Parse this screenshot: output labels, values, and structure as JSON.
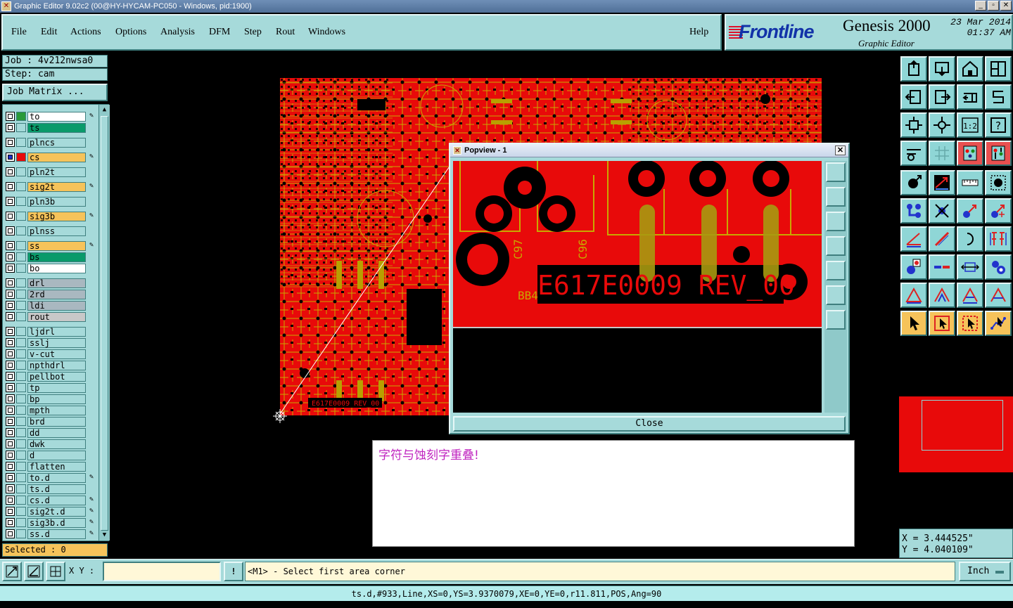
{
  "window": {
    "title": "Graphic Editor 9.02c2 (00@HY-HYCAM-PC050 - Windows, pid:1900)",
    "min": "_",
    "max": "▫",
    "close": "✕",
    "app_glyph": "✕"
  },
  "menu": {
    "file": "File",
    "edit": "Edit",
    "actions": "Actions",
    "options": "Options",
    "analysis": "Analysis",
    "dfm": "DFM",
    "step": "Step",
    "rout": "Rout",
    "windows": "Windows",
    "help": "Help"
  },
  "brand": {
    "logo": "Frontline",
    "product": "Genesis 2000",
    "subtitle": "Graphic Editor",
    "date": "23 Mar 2014",
    "time": "01:37 AM"
  },
  "job": {
    "job_label": "Job : 4v212nwsa0",
    "step_label": "Step: cam",
    "matrix_button": "Job Matrix ..."
  },
  "layers": [
    {
      "name": "to",
      "bg": "#ffffff",
      "swatch": "#2a9a3a",
      "pen": true
    },
    {
      "name": "ts",
      "bg": "#0a9a6a",
      "swatch": "",
      "pen": false
    },
    {
      "name": "plncs",
      "bg": "#a6dada",
      "swatch": "",
      "pen": false
    },
    {
      "name": "cs",
      "bg": "#f6c35a",
      "swatch": "#e80a0a",
      "pen": true,
      "active": true
    },
    {
      "name": "pln2t",
      "bg": "#a6dada",
      "swatch": "",
      "pen": false
    },
    {
      "name": "sig2t",
      "bg": "#f6c35a",
      "swatch": "",
      "pen": true
    },
    {
      "name": "pln3b",
      "bg": "#a6dada",
      "swatch": "",
      "pen": false
    },
    {
      "name": "sig3b",
      "bg": "#f6c35a",
      "swatch": "",
      "pen": true
    },
    {
      "name": "plnss",
      "bg": "#a6dada",
      "swatch": "",
      "pen": false
    },
    {
      "name": "ss",
      "bg": "#f6c35a",
      "swatch": "",
      "pen": true
    },
    {
      "name": "bs",
      "bg": "#0a9a6a",
      "swatch": "",
      "pen": false
    },
    {
      "name": "bo",
      "bg": "#ffffff",
      "swatch": "",
      "pen": false
    },
    {
      "name": "drl",
      "bg": "#a9b8c0",
      "swatch": "",
      "pen": false
    },
    {
      "name": "2rd",
      "bg": "#a9b8c0",
      "swatch": "",
      "pen": false
    },
    {
      "name": "ldi",
      "bg": "#a9b8c0",
      "swatch": "",
      "pen": false
    },
    {
      "name": "rout",
      "bg": "#c8c8c8",
      "swatch": "",
      "pen": false
    },
    {
      "name": "ljdrl",
      "bg": "#a6dada",
      "swatch": "",
      "pen": false
    },
    {
      "name": "sslj",
      "bg": "#a6dada",
      "swatch": "",
      "pen": false
    },
    {
      "name": "v-cut",
      "bg": "#a6dada",
      "swatch": "",
      "pen": false
    },
    {
      "name": "npthdrl",
      "bg": "#a6dada",
      "swatch": "",
      "pen": false
    },
    {
      "name": "pellbot",
      "bg": "#a6dada",
      "swatch": "",
      "pen": false
    },
    {
      "name": "tp",
      "bg": "#a6dada",
      "swatch": "",
      "pen": false
    },
    {
      "name": "bp",
      "bg": "#a6dada",
      "swatch": "",
      "pen": false
    },
    {
      "name": "mpth",
      "bg": "#a6dada",
      "swatch": "",
      "pen": false
    },
    {
      "name": "brd",
      "bg": "#a6dada",
      "swatch": "",
      "pen": false
    },
    {
      "name": "dd",
      "bg": "#a6dada",
      "swatch": "",
      "pen": false
    },
    {
      "name": "dwk",
      "bg": "#a6dada",
      "swatch": "",
      "pen": false
    },
    {
      "name": "d",
      "bg": "#a6dada",
      "swatch": "",
      "pen": false
    },
    {
      "name": "flatten",
      "bg": "#a6dada",
      "swatch": "",
      "pen": false
    },
    {
      "name": "to.d",
      "bg": "#a6dada",
      "swatch": "",
      "pen": true
    },
    {
      "name": "ts.d",
      "bg": "#a6dada",
      "swatch": "",
      "pen": false
    },
    {
      "name": "cs.d",
      "bg": "#a6dada",
      "swatch": "",
      "pen": true
    },
    {
      "name": "sig2t.d",
      "bg": "#a6dada",
      "swatch": "",
      "pen": true
    },
    {
      "name": "sig3b.d",
      "bg": "#a6dada",
      "swatch": "",
      "pen": true
    },
    {
      "name": "ss.d",
      "bg": "#a6dada",
      "swatch": "",
      "pen": true
    }
  ],
  "selected_label": "Selected : 0",
  "board_silk_text": "E617E0009 REV_00",
  "popview": {
    "title": "Popview - 1",
    "close_x": "✕",
    "close_button": "Close",
    "labels": {
      "c97": "C97",
      "c96": "C96",
      "bb4": "BB4",
      "main_text": "E617E0009 REV_00"
    }
  },
  "message": "字符与蚀刻字重叠!",
  "coords": {
    "x": "X = 3.444525\"",
    "y": "Y = 4.040109\""
  },
  "bottom": {
    "xy_label": "X Y :",
    "xy_value": "",
    "alert": "!",
    "prompt": "<M1> - Select first area corner",
    "unit": "Inch"
  },
  "status": "ts.d,#933,Line,XS=0,YS=3.9370079,XE=0,YE=0,r11.811,POS,Ang=90",
  "icon_labels": {
    "one_to_two": "1:2",
    "help": "?"
  }
}
